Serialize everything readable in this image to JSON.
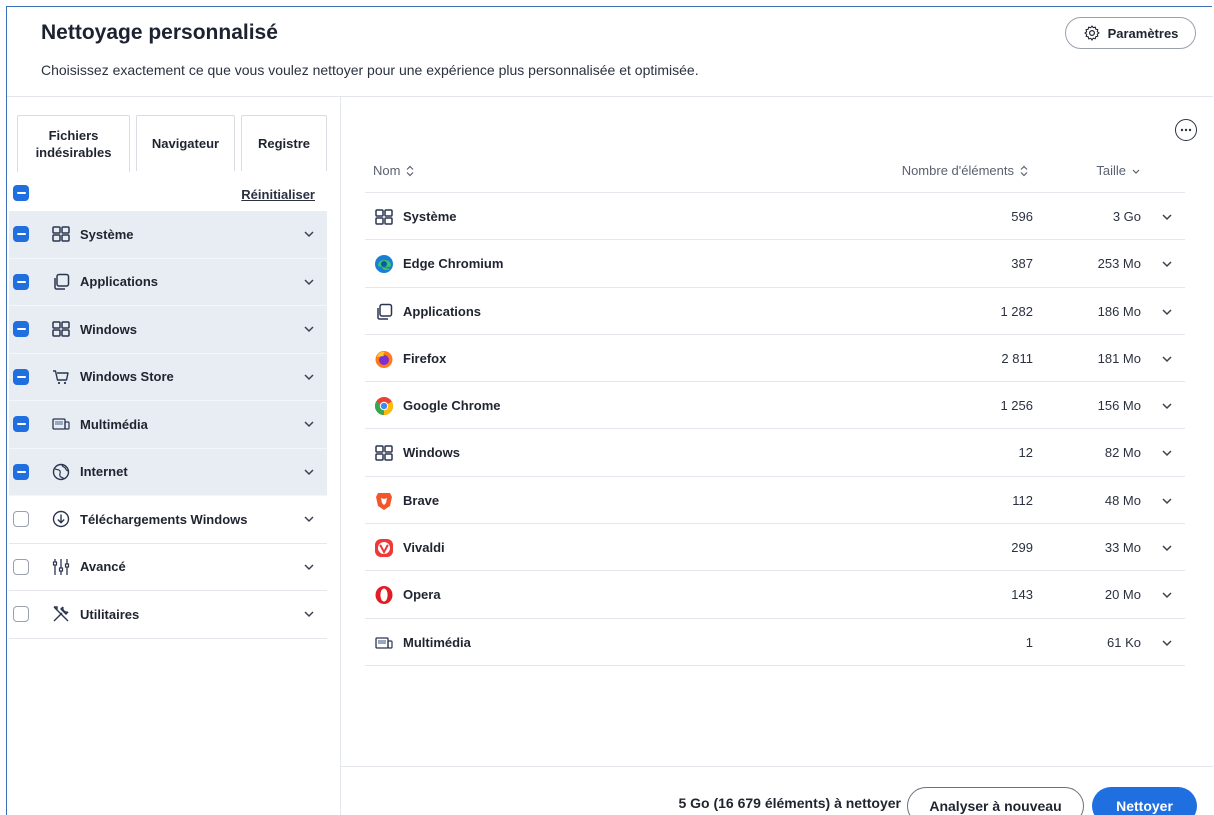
{
  "header": {
    "title": "Nettoyage personnalisé",
    "subtitle": "Choisissez exactement ce que vous voulez nettoyer pour une expérience plus personnalisée et optimisée.",
    "settings_label": "Paramètres"
  },
  "tabs": [
    {
      "label": "Fichiers indésirables",
      "active": true
    },
    {
      "label": "Navigateur",
      "active": false
    },
    {
      "label": "Registre",
      "active": false
    }
  ],
  "reset_label": "Réinitialiser",
  "categories": [
    {
      "label": "Système",
      "icon": "grid-icon",
      "checked": true
    },
    {
      "label": "Applications",
      "icon": "copy-icon",
      "checked": true
    },
    {
      "label": "Windows",
      "icon": "grid-icon",
      "checked": true
    },
    {
      "label": "Windows Store",
      "icon": "cart-icon",
      "checked": true
    },
    {
      "label": "Multimédia",
      "icon": "media-icon",
      "checked": true
    },
    {
      "label": "Internet",
      "icon": "globe-icon",
      "checked": true
    },
    {
      "label": "Téléchargements Windows",
      "icon": "download-icon",
      "checked": false
    },
    {
      "label": "Avancé",
      "icon": "sliders-icon",
      "checked": false
    },
    {
      "label": "Utilitaires",
      "icon": "tools-icon",
      "checked": false
    }
  ],
  "table": {
    "col_name": "Nom",
    "col_count": "Nombre d'éléments",
    "col_size": "Taille",
    "rows": [
      {
        "name": "Système",
        "icon": "grid-icon",
        "count": "596",
        "size": "3 Go"
      },
      {
        "name": "Edge Chromium",
        "icon": "edge-icon",
        "count": "387",
        "size": "253 Mo"
      },
      {
        "name": "Applications",
        "icon": "copy-icon",
        "count": "1 282",
        "size": "186 Mo"
      },
      {
        "name": "Firefox",
        "icon": "firefox-icon",
        "count": "2 811",
        "size": "181 Mo"
      },
      {
        "name": "Google Chrome",
        "icon": "chrome-icon",
        "count": "1 256",
        "size": "156 Mo"
      },
      {
        "name": "Windows",
        "icon": "grid-icon",
        "count": "12",
        "size": "82 Mo"
      },
      {
        "name": "Brave",
        "icon": "brave-icon",
        "count": "112",
        "size": "48 Mo"
      },
      {
        "name": "Vivaldi",
        "icon": "vivaldi-icon",
        "count": "299",
        "size": "33 Mo"
      },
      {
        "name": "Opera",
        "icon": "opera-icon",
        "count": "143",
        "size": "20 Mo"
      },
      {
        "name": "Multimédia",
        "icon": "media-icon",
        "count": "1",
        "size": "61 Ko"
      }
    ]
  },
  "footer": {
    "summary": "5 Go (16 679 éléments) à nettoyer",
    "rescan_label": "Analyser à nouveau",
    "clean_label": "Nettoyer"
  },
  "colors": {
    "accent": "#1f6fe0",
    "selected_row_bg": "#e8ecf3"
  }
}
